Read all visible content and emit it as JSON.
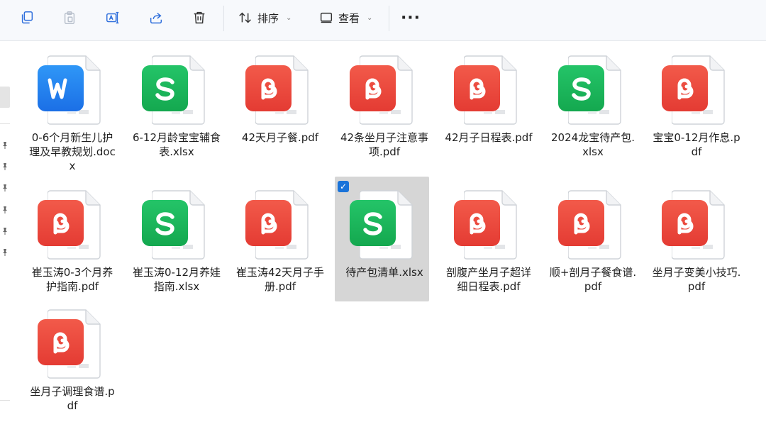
{
  "toolbar": {
    "sort_label": "排序",
    "view_label": "查看",
    "more_label": "···"
  },
  "files": [
    {
      "name": "0-6个月新生儿护理及早教规划.docx",
      "type": "word",
      "icon": "wps-word-icon",
      "selected": false
    },
    {
      "name": "6-12月龄宝宝辅食表.xlsx",
      "type": "sheet",
      "icon": "wps-sheet-icon",
      "selected": false
    },
    {
      "name": "42天月子餐.pdf",
      "type": "pdf",
      "icon": "wps-pdf-icon",
      "selected": false
    },
    {
      "name": "42条坐月子注意事项.pdf",
      "type": "pdf",
      "icon": "wps-pdf-icon",
      "selected": false
    },
    {
      "name": "42月子日程表.pdf",
      "type": "pdf",
      "icon": "wps-pdf-icon",
      "selected": false
    },
    {
      "name": "2024龙宝待产包.xlsx",
      "type": "sheet",
      "icon": "wps-sheet-icon",
      "selected": false
    },
    {
      "name": "宝宝0-12月作息.pdf",
      "type": "pdf",
      "icon": "wps-pdf-icon",
      "selected": false
    },
    {
      "name": "崔玉涛0-3个月养护指南.pdf",
      "type": "pdf",
      "icon": "wps-pdf-icon",
      "selected": false
    },
    {
      "name": "崔玉涛0-12月养娃指南.xlsx",
      "type": "sheet",
      "icon": "wps-sheet-icon",
      "selected": false
    },
    {
      "name": "崔玉涛42天月子手册.pdf",
      "type": "pdf",
      "icon": "wps-pdf-icon",
      "selected": false
    },
    {
      "name": "待产包清单.xlsx",
      "type": "sheet",
      "icon": "wps-sheet-icon",
      "selected": true
    },
    {
      "name": "剖腹产坐月子超详细日程表.pdf",
      "type": "pdf",
      "icon": "wps-pdf-icon",
      "selected": false
    },
    {
      "name": "顺+剖月子餐食谱.pdf",
      "type": "pdf",
      "icon": "wps-pdf-icon",
      "selected": false
    },
    {
      "name": "坐月子变美小技巧.pdf",
      "type": "pdf",
      "icon": "wps-pdf-icon",
      "selected": false
    },
    {
      "name": "坐月子调理食谱.pdf",
      "type": "pdf",
      "icon": "wps-pdf-icon",
      "selected": false
    }
  ],
  "colors": {
    "word": "#1b6fe6",
    "sheet": "#14a84f",
    "pdf": "#e43b33",
    "selection": "#d6d6d6",
    "checkbox": "#1a73d9"
  }
}
